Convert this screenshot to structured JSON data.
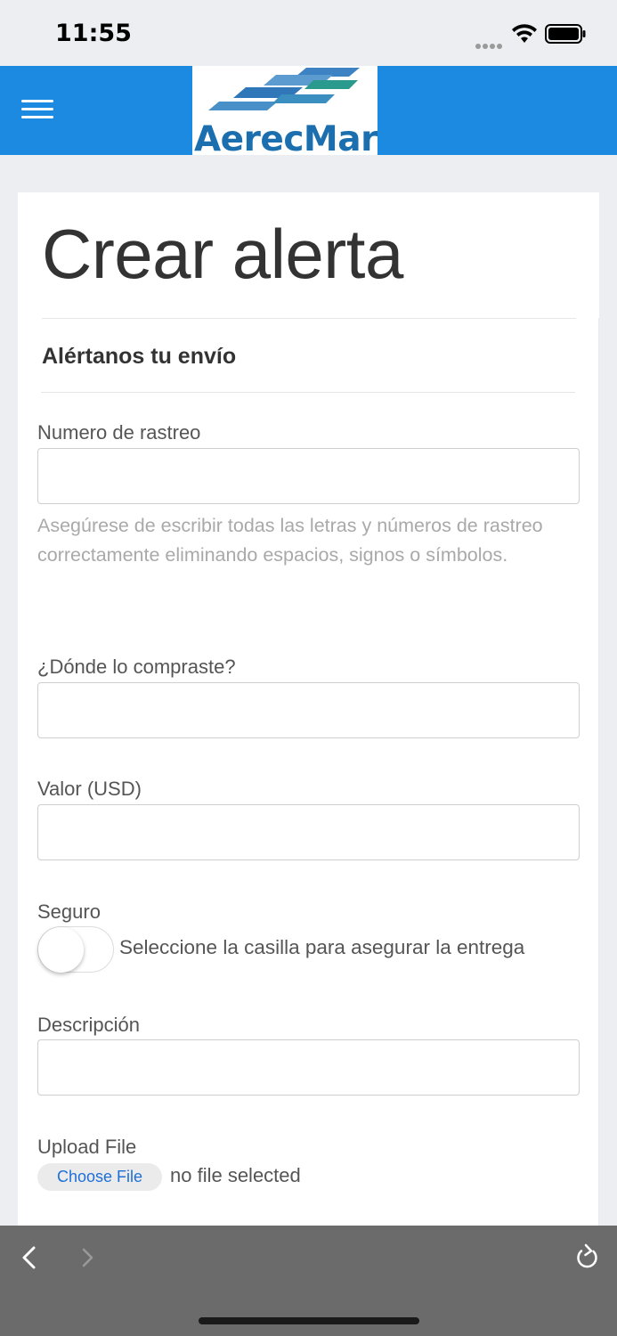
{
  "status_bar": {
    "time": "11:55"
  },
  "header": {
    "logo_text": "AerecMar",
    "brand_color": "#1d8ae2"
  },
  "page": {
    "title": "Crear alerta",
    "section_heading": "Alértanos tu envío"
  },
  "form": {
    "tracking": {
      "label": "Numero de rastreo",
      "value": "",
      "help": "Asegúrese de escribir todas las letras y números de rastreo correctamente eliminando espacios, signos o símbolos."
    },
    "store": {
      "label": "¿Dónde lo compraste?",
      "value": ""
    },
    "value_usd": {
      "label": "Valor (USD)",
      "value": ""
    },
    "insurance": {
      "label": "Seguro",
      "toggle_text": "Seleccione la casilla para asegurar la entrega",
      "checked": false
    },
    "description": {
      "label": "Descripción",
      "value": ""
    },
    "upload": {
      "label": "Upload File",
      "button": "Choose File",
      "status": "no file selected"
    }
  },
  "browser": {
    "icons": [
      "back-icon",
      "forward-icon",
      "reload-icon"
    ]
  }
}
